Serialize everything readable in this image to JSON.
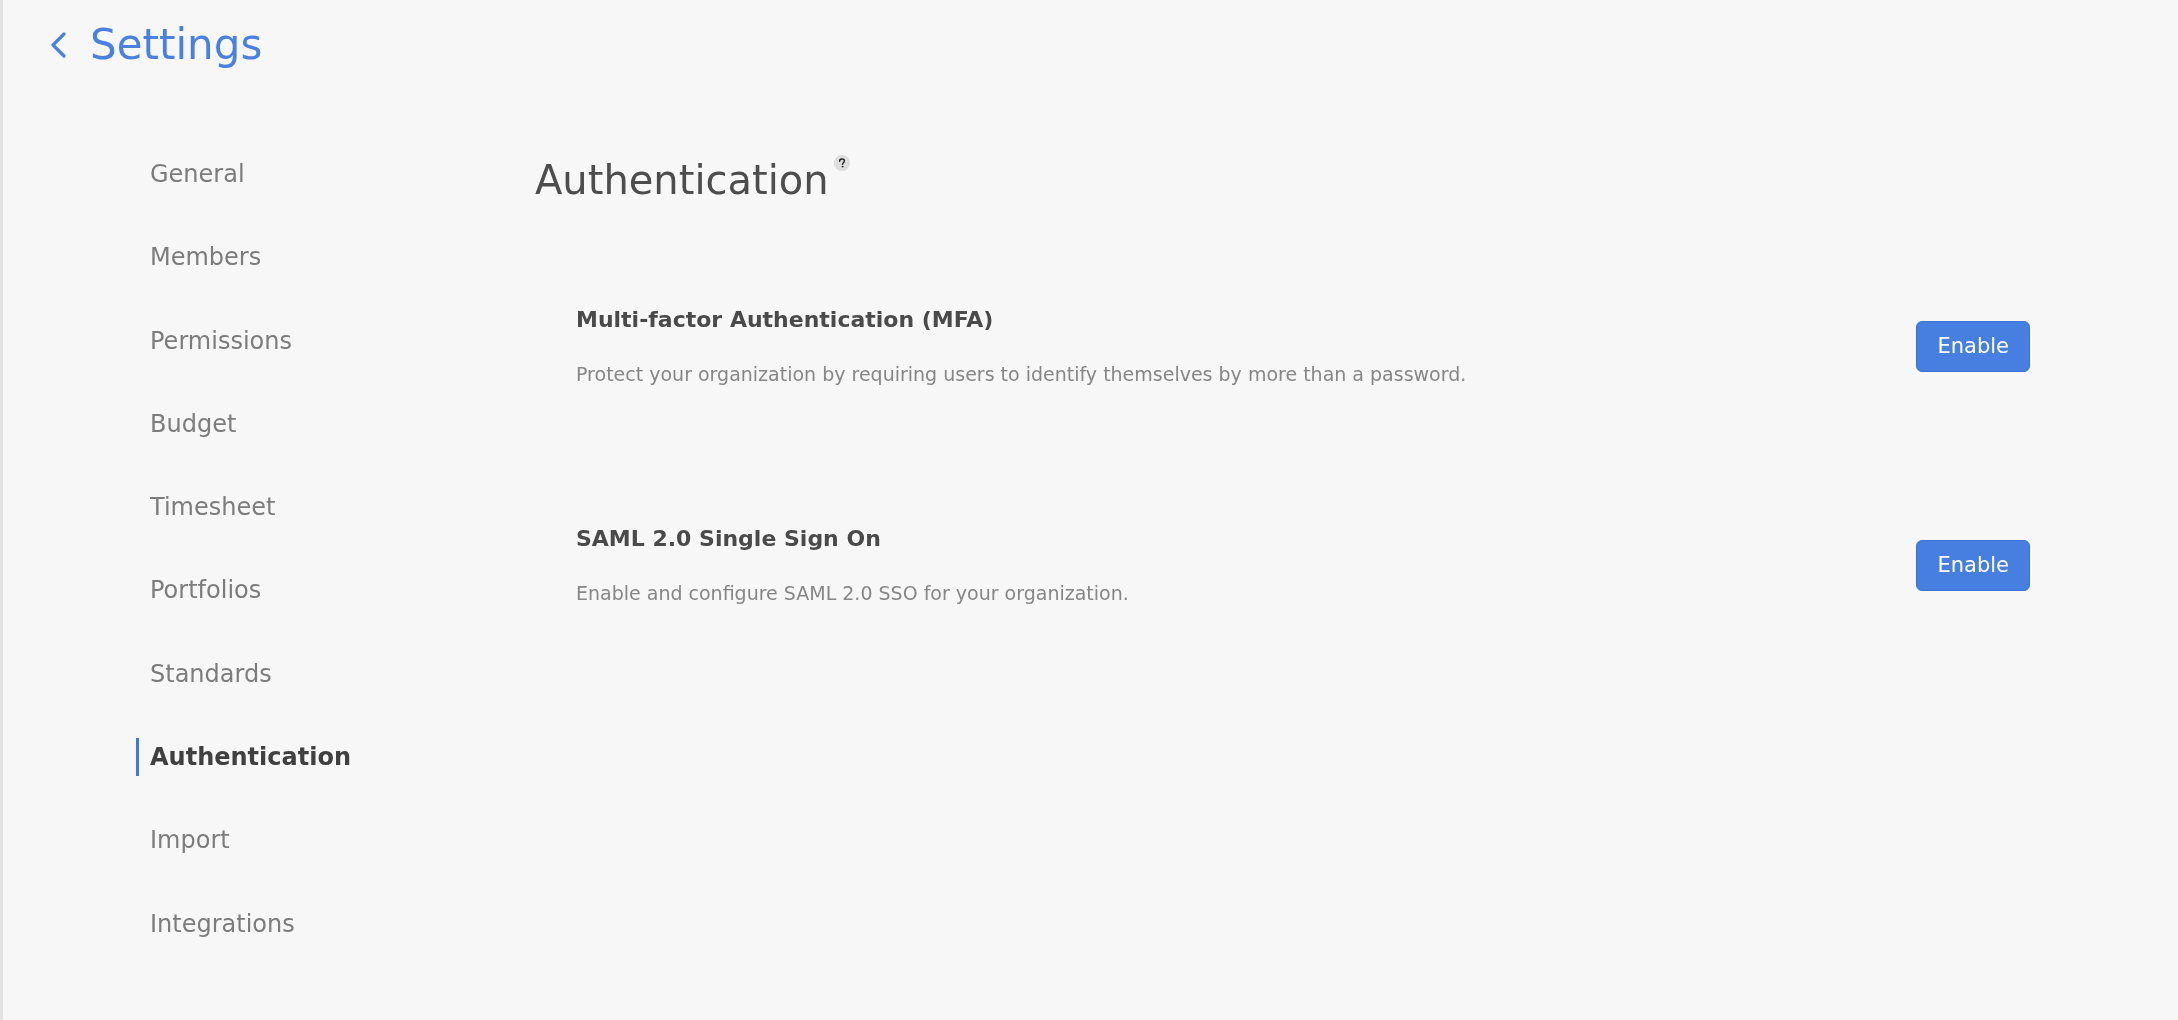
{
  "header": {
    "title": "Settings"
  },
  "sidebar": {
    "items": [
      {
        "label": "General",
        "selected": false
      },
      {
        "label": "Members",
        "selected": false
      },
      {
        "label": "Permissions",
        "selected": false
      },
      {
        "label": "Budget",
        "selected": false
      },
      {
        "label": "Timesheet",
        "selected": false
      },
      {
        "label": "Portfolios",
        "selected": false
      },
      {
        "label": "Standards",
        "selected": false
      },
      {
        "label": "Authentication",
        "selected": true
      },
      {
        "label": "Import",
        "selected": false
      },
      {
        "label": "Integrations",
        "selected": false
      }
    ]
  },
  "main": {
    "title": "Authentication",
    "sections": [
      {
        "title": "Multi-factor Authentication (MFA)",
        "description": "Protect your organization by requiring users to identify themselves by more than a password.",
        "button": "Enable"
      },
      {
        "title": "SAML 2.0 Single Sign On",
        "description": "Enable and configure SAML 2.0 SSO for your organization.",
        "button": "Enable"
      }
    ]
  }
}
